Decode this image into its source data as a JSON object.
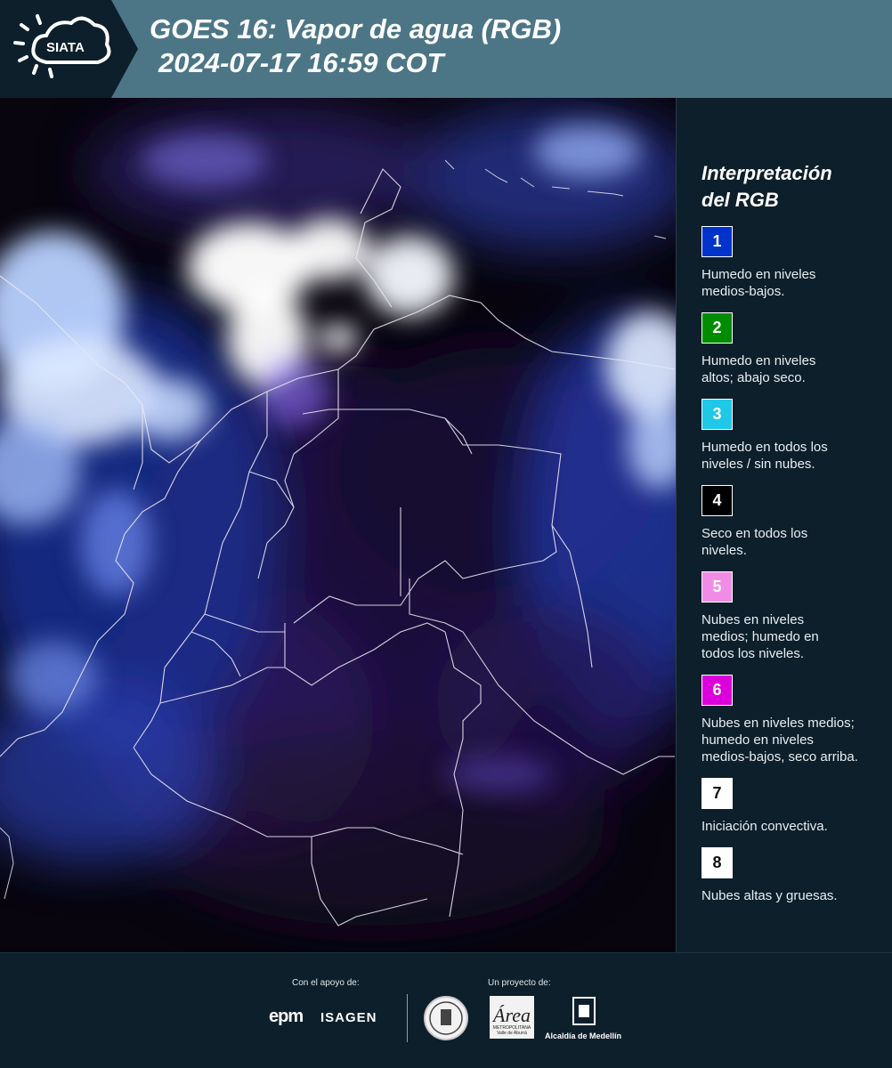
{
  "header": {
    "brand": "SIATA",
    "title_line1": "GOES 16: Vapor de agua (RGB)",
    "title_line2": "2024-07-17 16:59 COT",
    "bg_color": "#4c7686",
    "logo_bg_color": "#0d1f2b"
  },
  "map": {
    "icon": "satellite-map-image"
  },
  "legend": {
    "title_line1": "Interpretación",
    "title_line2": "del RGB",
    "items": [
      {
        "number": "1",
        "color": "#0033cc",
        "desc_line1": "Humedo en niveles",
        "desc_line2": "medios-bajos.",
        "desc_line3": ""
      },
      {
        "number": "2",
        "color": "#008c00",
        "desc_line1": "Humedo en niveles",
        "desc_line2": "altos; abajo seco.",
        "desc_line3": ""
      },
      {
        "number": "3",
        "color": "#1ec8e6",
        "desc_line1": "Humedo en todos los",
        "desc_line2": "niveles / sin nubes.",
        "desc_line3": ""
      },
      {
        "number": "4",
        "color": "#000000",
        "desc_line1": "Seco en todos los",
        "desc_line2": "niveles.",
        "desc_line3": ""
      },
      {
        "number": "5",
        "color": "#f08ce6",
        "desc_line1": "Nubes en niveles",
        "desc_line2": "medios; humedo en",
        "desc_line3": "todos los niveles."
      },
      {
        "number": "6",
        "color": "#dc00dc",
        "desc_line1": "Nubes en niveles medios;",
        "desc_line2": "humedo en niveles",
        "desc_line3": "medios-bajos, seco arriba."
      },
      {
        "number": "7",
        "color": "#ffffff",
        "desc_line1": "Iniciación convectiva.",
        "desc_line2": "",
        "desc_line3": ""
      },
      {
        "number": "8",
        "color": "#ffffff",
        "desc_line1": "Nubes altas y gruesas.",
        "desc_line2": "",
        "desc_line3": ""
      }
    ]
  },
  "footer": {
    "support_label": "Con el apoyo de:",
    "project_label": "Un proyecto de:",
    "sponsor1": "epm",
    "sponsor2": "ISAGEN",
    "area_letter": "Área",
    "area_sub1": "METROPOLITANA",
    "area_sub2": "Valle de Aburrá",
    "alcaldia": "Alcaldía de Medellín"
  }
}
